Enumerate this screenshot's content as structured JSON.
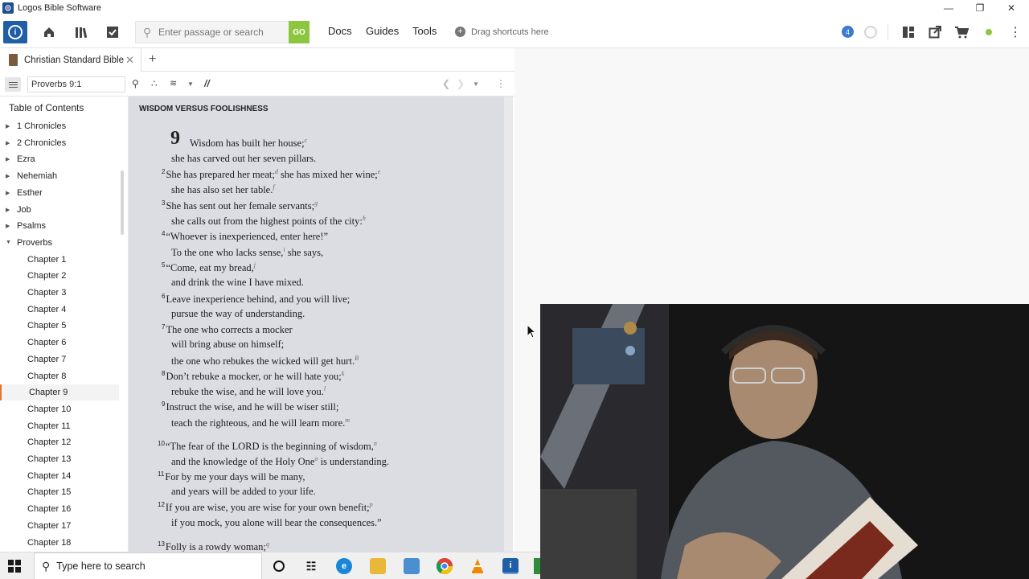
{
  "window": {
    "title": "Logos Bible Software",
    "controls": [
      "minimize",
      "restore",
      "close"
    ]
  },
  "toolbar": {
    "search_placeholder": "Enter passage or search",
    "go_label": "GO",
    "menu": [
      "Docs",
      "Guides",
      "Tools"
    ],
    "shortcuts_label": "Drag shortcuts here",
    "notification_count": "4"
  },
  "tab": {
    "label": "Christian Standard Bible"
  },
  "resource": {
    "reference": "Proverbs 9:1",
    "parallel_label": "//"
  },
  "toc": {
    "title": "Table of Contents",
    "items": [
      {
        "label": "1 Chronicles",
        "kind": "book",
        "expanded": false
      },
      {
        "label": "2 Chronicles",
        "kind": "book",
        "expanded": false
      },
      {
        "label": "Ezra",
        "kind": "book",
        "expanded": false
      },
      {
        "label": "Nehemiah",
        "kind": "book",
        "expanded": false
      },
      {
        "label": "Esther",
        "kind": "book",
        "expanded": false
      },
      {
        "label": "Job",
        "kind": "book",
        "expanded": false
      },
      {
        "label": "Psalms",
        "kind": "book",
        "expanded": false
      },
      {
        "label": "Proverbs",
        "kind": "book",
        "expanded": true
      },
      {
        "label": "Chapter 1",
        "kind": "chapter"
      },
      {
        "label": "Chapter 2",
        "kind": "chapter"
      },
      {
        "label": "Chapter 3",
        "kind": "chapter"
      },
      {
        "label": "Chapter 4",
        "kind": "chapter"
      },
      {
        "label": "Chapter 5",
        "kind": "chapter"
      },
      {
        "label": "Chapter 6",
        "kind": "chapter"
      },
      {
        "label": "Chapter 7",
        "kind": "chapter"
      },
      {
        "label": "Chapter 8",
        "kind": "chapter"
      },
      {
        "label": "Chapter 9",
        "kind": "chapter",
        "selected": true
      },
      {
        "label": "Chapter 10",
        "kind": "chapter"
      },
      {
        "label": "Chapter 11",
        "kind": "chapter"
      },
      {
        "label": "Chapter 12",
        "kind": "chapter"
      },
      {
        "label": "Chapter 13",
        "kind": "chapter"
      },
      {
        "label": "Chapter 14",
        "kind": "chapter"
      },
      {
        "label": "Chapter 15",
        "kind": "chapter"
      },
      {
        "label": "Chapter 16",
        "kind": "chapter"
      },
      {
        "label": "Chapter 17",
        "kind": "chapter"
      },
      {
        "label": "Chapter 18",
        "kind": "chapter"
      }
    ]
  },
  "passage": {
    "heading": "WISDOM VERSUS FOOLISHNESS",
    "chapter_number": "9",
    "lines": [
      {
        "verse": "",
        "text": "Wisdom has built her house;",
        "fn": "c"
      },
      {
        "verse": "",
        "text": "she has carved out her seven pillars.",
        "fn": ""
      },
      {
        "verse": "2",
        "text": "She has prepared her meat;",
        "fn": "d",
        "text2": " she has mixed her wine;",
        "fn2": "e"
      },
      {
        "verse": "",
        "text": "she has also set her table.",
        "fn": "f"
      },
      {
        "verse": "3",
        "text": "She has sent out her female servants;",
        "fn": "g"
      },
      {
        "verse": "",
        "text": "she calls out from the highest points of the city:",
        "fn": "h"
      },
      {
        "verse": "4",
        "text": "“Whoever is inexperienced, enter here!”",
        "fn": ""
      },
      {
        "verse": "",
        "text": "To the one who lacks sense,",
        "fn": "i",
        "text2": " she says,",
        "fn2": ""
      },
      {
        "verse": "5",
        "text": "“Come, eat my bread,",
        "fn": "j"
      },
      {
        "verse": "",
        "text": "and drink the wine I have mixed.",
        "fn": ""
      },
      {
        "verse": "6",
        "text": "Leave inexperience behind, and you will live;",
        "fn": ""
      },
      {
        "verse": "",
        "text": "pursue the way of understanding.",
        "fn": ""
      },
      {
        "verse": "7",
        "text": "The one who corrects a mocker",
        "fn": ""
      },
      {
        "verse": "",
        "text": "will bring abuse on himself;",
        "fn": ""
      },
      {
        "verse": "",
        "text": "the one who rebukes the wicked will get hurt.",
        "fn": "B"
      },
      {
        "verse": "8",
        "text": "Don’t rebuke a mocker, or he will hate you;",
        "fn": "k"
      },
      {
        "verse": "",
        "text": "rebuke the wise, and he will love you.",
        "fn": "l"
      },
      {
        "verse": "9",
        "text": "Instruct the wise, and he will be wiser still;",
        "fn": ""
      },
      {
        "verse": "",
        "text": "teach the righteous, and he will learn more.",
        "fn": "m"
      },
      {
        "verse": "10",
        "text": "“The fear of the LORD is the beginning of wisdom,",
        "fn": "n"
      },
      {
        "verse": "",
        "text": "and the knowledge of the Holy One",
        "fn": "o",
        "text2": " is understanding.",
        "fn2": ""
      },
      {
        "verse": "11",
        "text": "For by me your days will be many,",
        "fn": ""
      },
      {
        "verse": "",
        "text": "and years will be added to your life.",
        "fn": ""
      },
      {
        "verse": "12",
        "text": "If you are wise, you are wise for your own benefit;",
        "fn": "p"
      },
      {
        "verse": "",
        "text": "if you mock, you alone will bear the consequences.”",
        "fn": ""
      },
      {
        "verse": "13",
        "text": "Folly is a rowdy woman;",
        "fn": "q"
      }
    ]
  },
  "taskbar": {
    "search_placeholder": "Type here to search",
    "apps": [
      "cortana-circle",
      "task-view",
      "edge",
      "file-explorer",
      "app-blue",
      "chrome",
      "vlc",
      "logos",
      "green-app"
    ]
  },
  "colors": {
    "accent_blue": "#1f5fa8",
    "go_green": "#8cc63f",
    "passage_bg": "#dcdde3",
    "toc_selected_marker": "#e8732c"
  }
}
